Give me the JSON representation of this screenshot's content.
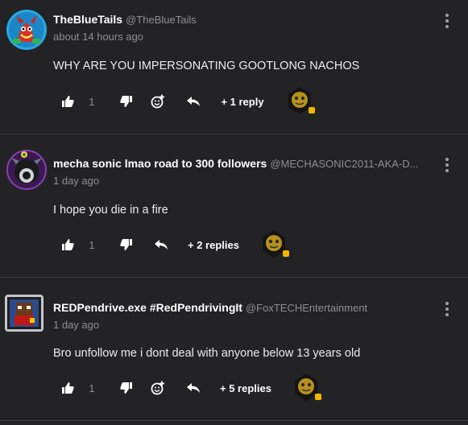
{
  "comments": [
    {
      "name": "TheBlueTails",
      "handle": "@TheBlueTails",
      "time": "about 14 hours ago",
      "text": "WHY ARE YOU IMPERSONATING GOOTLONG NACHOS",
      "likes": "1",
      "replies": "+ 1 reply"
    },
    {
      "name": "mecha sonic lmao road to 300 followers",
      "handle": "@MECHASONIC2011-AKA-D...",
      "time": "1 day ago",
      "text": "I hope you die in a fire",
      "likes": "1",
      "replies": "+ 2 replies"
    },
    {
      "name": "REDPendrive.exe #RedPendrivingIt",
      "handle": "@FoxTECHEntertainment",
      "time": "1 day ago",
      "text": "Bro unfollow me i dont deal with anyone below 13 years old",
      "likes": "1",
      "replies": "+ 5 replies"
    }
  ],
  "colors": {
    "background": "#232326",
    "divider": "#3c3c40",
    "muted": "#8e8e92"
  },
  "icons": [
    "thumbs-up-icon",
    "thumbs-down-icon",
    "add-emoji-icon",
    "reply-arrow-icon",
    "more-vertical-icon",
    "reaction-emoji-icon"
  ]
}
